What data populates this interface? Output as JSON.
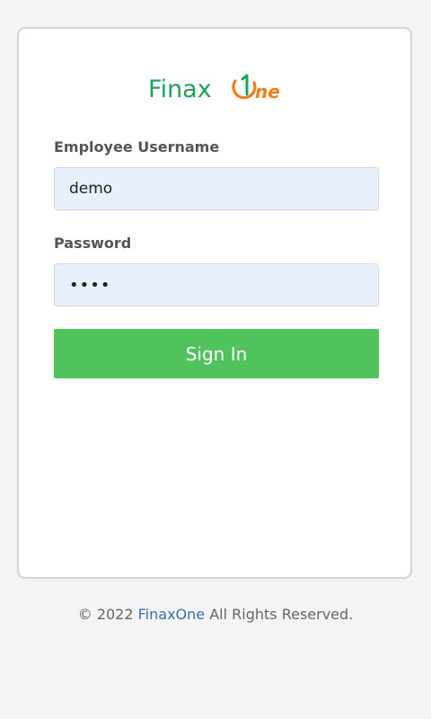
{
  "brand": {
    "logo_text": "FinaxOne",
    "logo_part_left": "Finax",
    "logo_part_right": "ne",
    "colors": {
      "green": "#1aa35a",
      "orange": "#f07d1a"
    }
  },
  "form": {
    "username_label": "Employee Username",
    "username_value": "demo",
    "password_label": "Password",
    "password_value": "demo",
    "signin_label": "Sign In"
  },
  "colors": {
    "button": "#50c35d",
    "input_bg": "#e8f0fe",
    "link": "#3a6fb0"
  },
  "footer": {
    "prefix": "© 2022",
    "link_text": "FinaxOne",
    "suffix": "All Rights Reserved."
  }
}
